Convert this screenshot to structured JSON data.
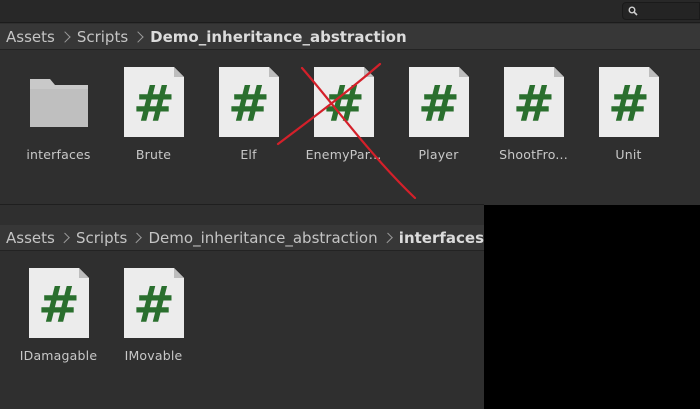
{
  "top_panel": {
    "breadcrumb": [
      "Assets",
      "Scripts",
      "Demo_inheritance_abstraction"
    ],
    "items": [
      {
        "name": "interfaces",
        "type": "folder"
      },
      {
        "name": "Brute",
        "type": "script"
      },
      {
        "name": "Elf",
        "type": "script"
      },
      {
        "name": "EnemyPar...",
        "type": "script"
      },
      {
        "name": "Player",
        "type": "script"
      },
      {
        "name": "ShootFro...",
        "type": "script"
      },
      {
        "name": "Unit",
        "type": "script"
      }
    ]
  },
  "bottom_panel": {
    "breadcrumb": [
      "Assets",
      "Scripts",
      "Demo_inheritance_abstraction",
      "interfaces"
    ],
    "items": [
      {
        "name": "IDamagable",
        "type": "script"
      },
      {
        "name": "IMovable",
        "type": "script"
      }
    ]
  },
  "icons": {
    "script": "csharp-script-icon",
    "folder": "folder-icon",
    "search": "search-icon"
  },
  "colors": {
    "panel_bg": "#2f2f2f",
    "breadcrumb_bg": "#373737",
    "script_page": "#ececec",
    "script_hash": "#2a6f2e",
    "folder": "#c9c9c9",
    "annotation": "#d4202a"
  }
}
